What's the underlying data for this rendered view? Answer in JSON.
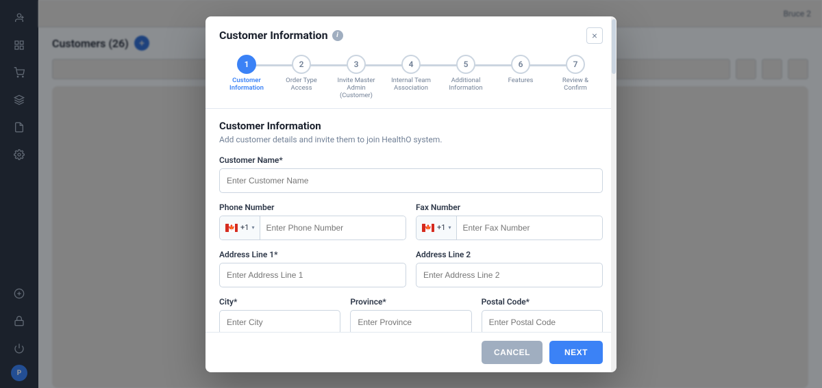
{
  "app": {
    "page_title": "Customers (26)"
  },
  "sidebar": {
    "icons": [
      {
        "name": "add-user-icon",
        "symbol": "👤",
        "active": false
      },
      {
        "name": "grid-icon",
        "symbol": "⊞",
        "active": false
      },
      {
        "name": "cart-icon",
        "symbol": "🛒",
        "active": false
      },
      {
        "name": "layers-icon",
        "symbol": "⬡",
        "active": false
      },
      {
        "name": "doc-icon",
        "symbol": "📄",
        "active": false
      },
      {
        "name": "settings-icon",
        "symbol": "⚙",
        "active": false
      },
      {
        "name": "down-icon",
        "symbol": "↓",
        "active": false
      },
      {
        "name": "plus-circle-icon",
        "symbol": "⊕",
        "active": false
      },
      {
        "name": "lock-icon",
        "symbol": "🔒",
        "active": false
      },
      {
        "name": "power-icon",
        "symbol": "⏻",
        "active": false
      }
    ]
  },
  "modal": {
    "title": "Customer Information",
    "close_label": "×",
    "steps": [
      {
        "number": "1",
        "label": "Customer\nInformation",
        "active": true
      },
      {
        "number": "2",
        "label": "Order Type Access",
        "active": false
      },
      {
        "number": "3",
        "label": "Invite Master\nAdmin (Customer)",
        "active": false
      },
      {
        "number": "4",
        "label": "Internal Team\nAssociation",
        "active": false
      },
      {
        "number": "5",
        "label": "Additional\nInformation",
        "active": false
      },
      {
        "number": "6",
        "label": "Features",
        "active": false
      },
      {
        "number": "7",
        "label": "Review & Confirm",
        "active": false
      }
    ],
    "section_title": "Customer Information",
    "section_subtitle": "Add customer details and invite them to join HealthO system.",
    "fields": {
      "customer_name_label": "Customer Name*",
      "customer_name_placeholder": "Enter Customer Name",
      "phone_label": "Phone Number",
      "phone_country_code": "+1",
      "phone_placeholder": "Enter Phone Number",
      "fax_label": "Fax Number",
      "fax_country_code": "+1",
      "fax_placeholder": "Enter Fax Number",
      "address1_label": "Address Line 1*",
      "address1_placeholder": "Enter Address Line 1",
      "address2_label": "Address Line 2",
      "address2_placeholder": "Enter Address Line 2",
      "city_label": "City*",
      "city_placeholder": "Enter City",
      "province_label": "Province*",
      "province_placeholder": "Enter Province",
      "postal_label": "Postal Code*",
      "postal_placeholder": "Enter Postal Code"
    },
    "cancel_label": "CANCEL",
    "next_label": "NEXT"
  }
}
